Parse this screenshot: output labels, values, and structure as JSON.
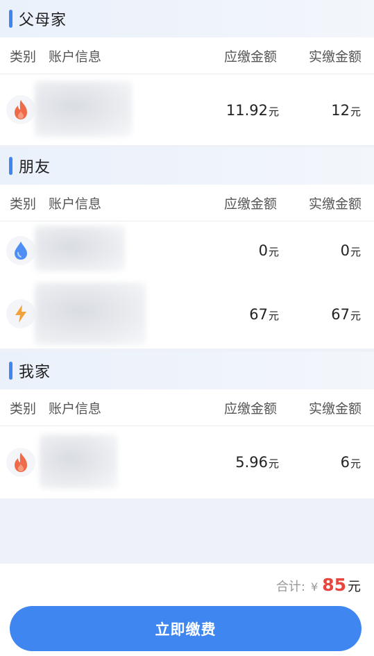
{
  "columns": {
    "type": "类别",
    "account": "账户信息",
    "due": "应缴金额",
    "actual": "实缴金额"
  },
  "groups": [
    {
      "title": "父母家",
      "rows": [
        {
          "icon": "fire-icon",
          "due": "11.92",
          "actual": "12"
        }
      ]
    },
    {
      "title": "朋友",
      "rows": [
        {
          "icon": "water-drop-icon",
          "due": "0",
          "actual": "0"
        },
        {
          "icon": "lightning-icon",
          "due": "67",
          "actual": "67"
        }
      ]
    },
    {
      "title": "我家",
      "rows": [
        {
          "icon": "fire-icon",
          "due": "5.96",
          "actual": "6"
        }
      ]
    }
  ],
  "unit": "元",
  "footer": {
    "total_label": "合计:",
    "currency": "¥",
    "total_value": "85",
    "total_unit": "元",
    "pay_button": "立即缴费"
  },
  "colors": {
    "accent": "#3f86f0",
    "fire": "#ee6a4a",
    "water": "#4f8ef5",
    "lightning": "#f2a23b",
    "total": "#e8453c"
  }
}
